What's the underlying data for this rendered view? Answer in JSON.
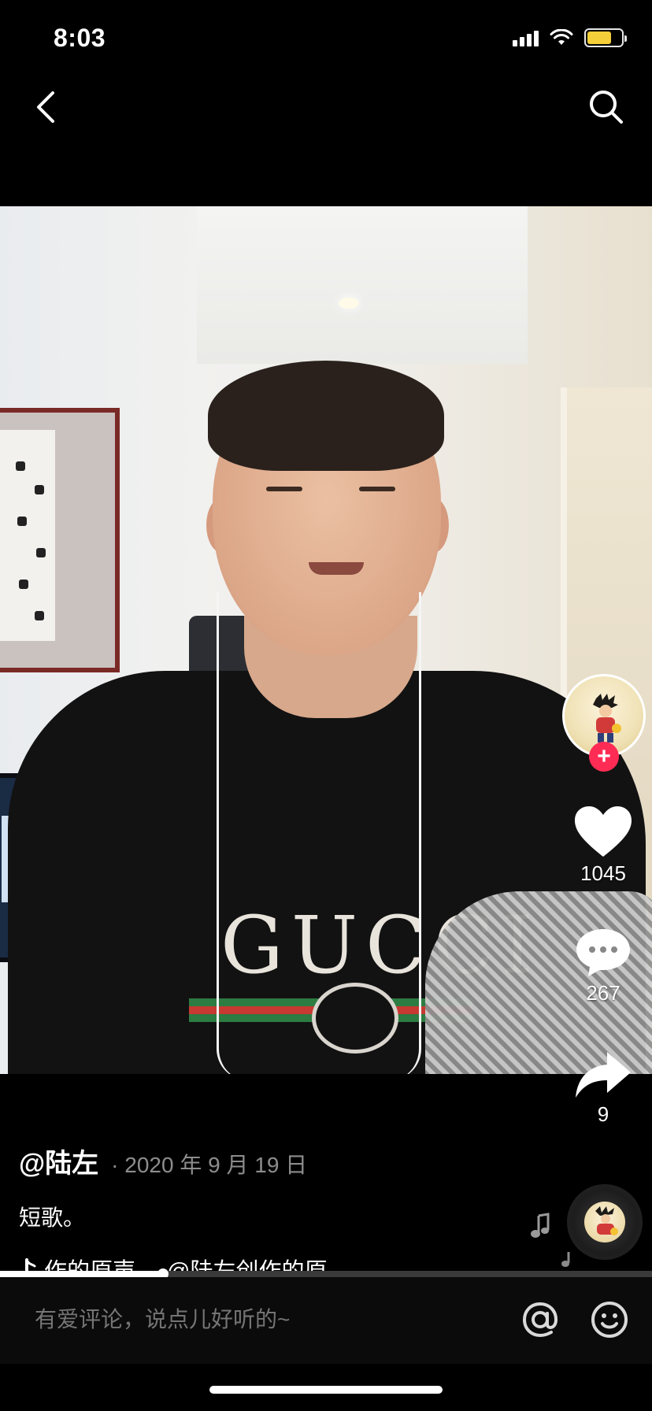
{
  "status_bar": {
    "time": "8:03",
    "battery_color": "#f4cf3a"
  },
  "nav": {
    "back_icon": "chevron-left-icon",
    "search_icon": "search-icon"
  },
  "video": {
    "shirt_logo_text": "GUCCI",
    "stats": {
      "likes": "1045",
      "comments": "267",
      "shares": "9"
    }
  },
  "caption": {
    "author": "@陆左",
    "date": "2020 年 9 月 19 日",
    "description": "短歌。",
    "music_text_1": "作的原声",
    "music_text_2": "@陆左创作的原"
  },
  "progress": {
    "fraction": 0.25
  },
  "comment_bar": {
    "placeholder": "有爱评论，说点儿好听的~"
  },
  "colors": {
    "accent": "#fe2c55",
    "background": "#000000"
  }
}
